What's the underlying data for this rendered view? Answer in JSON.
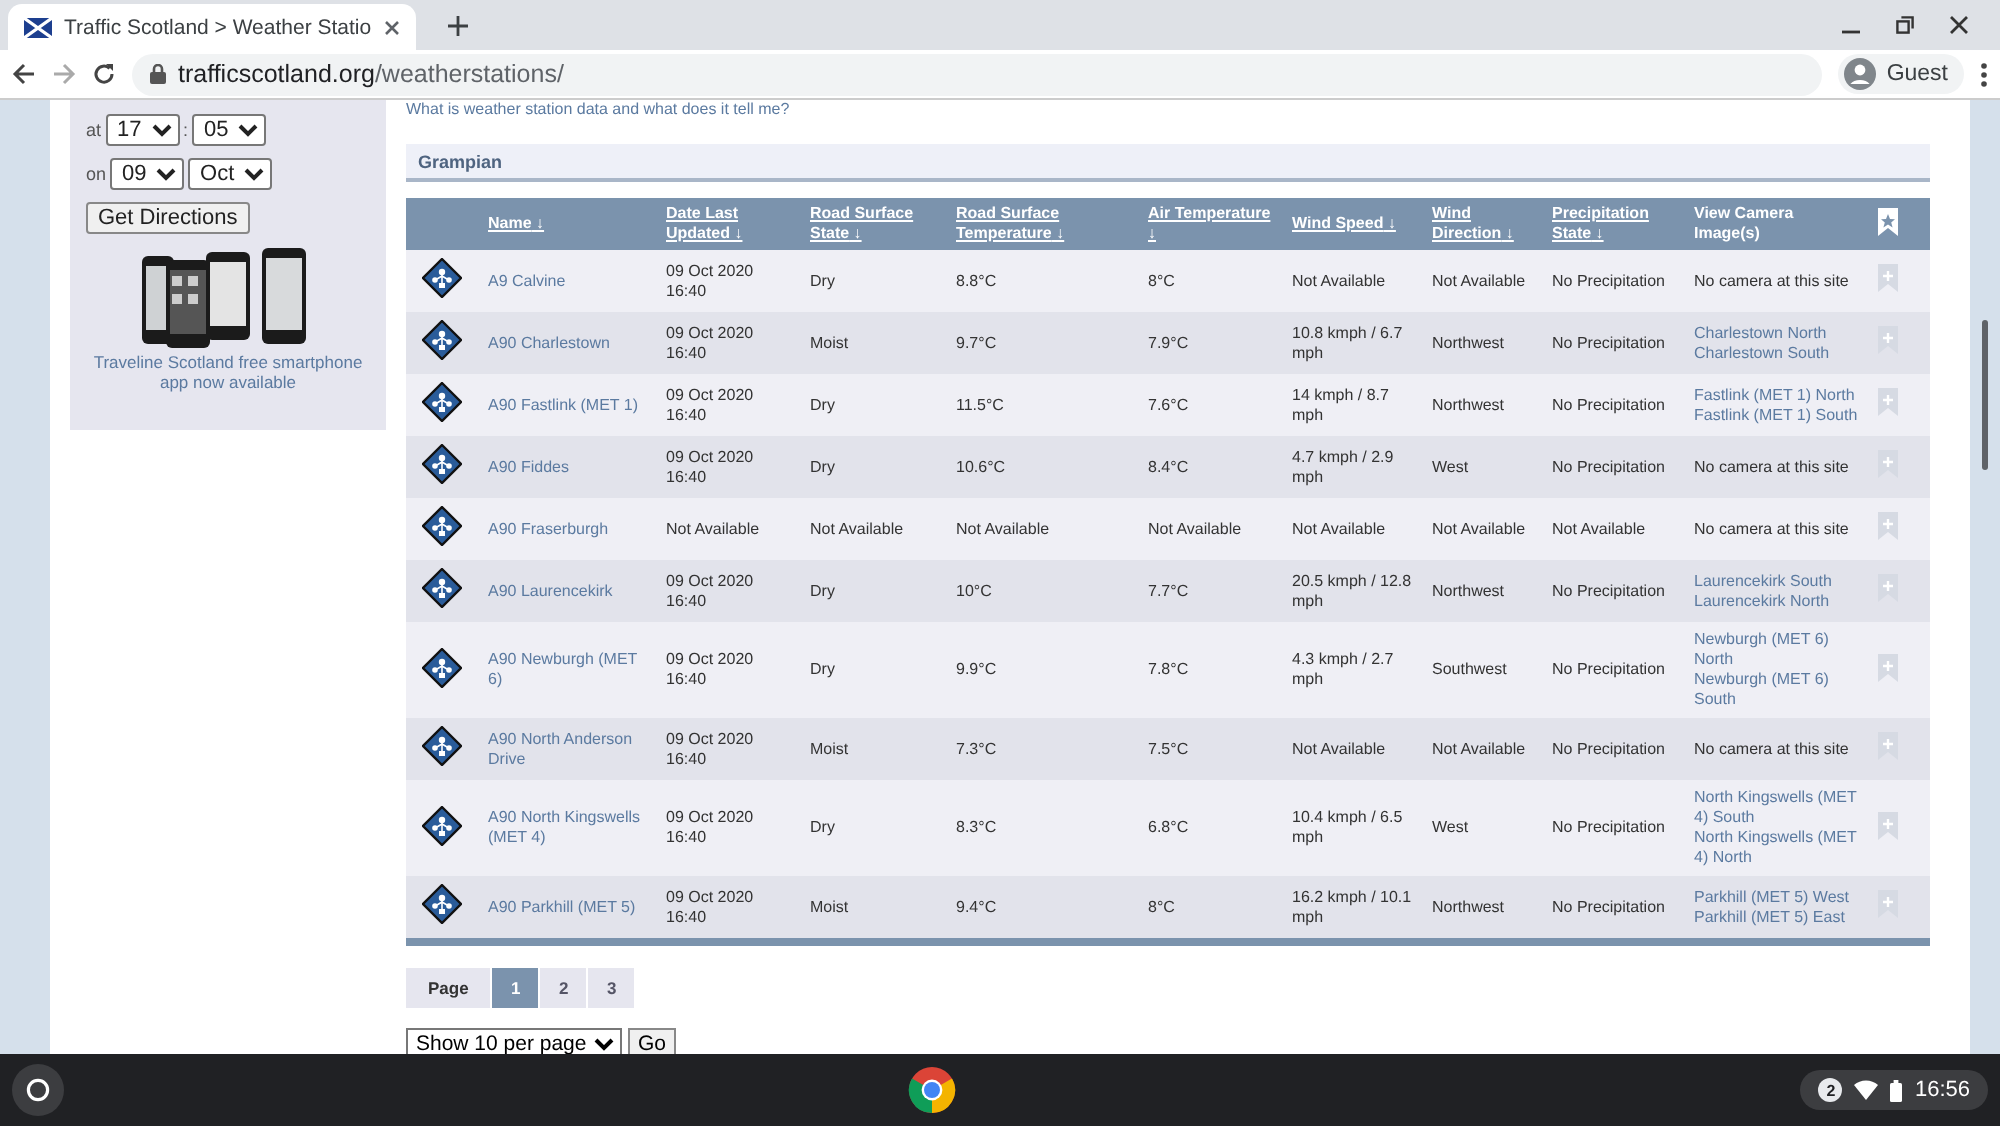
{
  "browser": {
    "tab_title": "Traffic Scotland > Weather Statio",
    "url_domain": "trafficscotland.org",
    "url_path": "/weatherstations/",
    "profile": "Guest"
  },
  "sidebar": {
    "time_label": "at",
    "hour": "17",
    "separator": ":",
    "minute": "05",
    "date_label": "on",
    "day": "09",
    "month": "Oct",
    "button": "Get Directions",
    "app_caption": "Traveline Scotland free smartphone app now available"
  },
  "intro_link": "What is weather station data and what does it tell me?",
  "region": "Grampian",
  "table": {
    "columns": [
      "Name",
      "Date Last Updated",
      "Road Surface State",
      "Road Surface Temperature",
      "Air Temperature",
      "Wind Speed",
      "Wind Direction",
      "Precipitation State",
      "View Camera Image(s)"
    ],
    "sortable": [
      true,
      true,
      true,
      true,
      true,
      true,
      true,
      true,
      false
    ],
    "sort_mark": "↓",
    "rows": [
      {
        "name": "A9 Calvine",
        "updated": "09 Oct 2020 16:40",
        "road_state": "Dry",
        "road_temp": "8.8°C",
        "air_temp": "8°C",
        "wind_speed": "Not Available",
        "wind_dir": "Not Available",
        "precip": "No Precipitation",
        "camera": {
          "kind": "none",
          "note": "No camera at this site"
        }
      },
      {
        "name": "A90 Charlestown",
        "updated": "09 Oct 2020 16:40",
        "road_state": "Moist",
        "road_temp": "9.7°C",
        "air_temp": "7.9°C",
        "wind_speed": "10.8 kmph / 6.7 mph",
        "wind_dir": "Northwest",
        "precip": "No Precipitation",
        "camera": {
          "kind": "links",
          "links": [
            "Charlestown North",
            "Charlestown South"
          ]
        }
      },
      {
        "name": "A90 Fastlink (MET 1)",
        "updated": "09 Oct 2020 16:40",
        "road_state": "Dry",
        "road_temp": "11.5°C",
        "air_temp": "7.6°C",
        "wind_speed": "14 kmph / 8.7 mph",
        "wind_dir": "Northwest",
        "precip": "No Precipitation",
        "camera": {
          "kind": "links",
          "links": [
            "Fastlink (MET 1) North",
            "Fastlink (MET 1) South"
          ]
        }
      },
      {
        "name": "A90 Fiddes",
        "updated": "09 Oct 2020 16:40",
        "road_state": "Dry",
        "road_temp": "10.6°C",
        "air_temp": "8.4°C",
        "wind_speed": "4.7 kmph / 2.9 mph",
        "wind_dir": "West",
        "precip": "No Precipitation",
        "camera": {
          "kind": "none",
          "note": "No camera at this site"
        }
      },
      {
        "name": "A90 Fraserburgh",
        "updated": "Not Available",
        "road_state": "Not Available",
        "road_temp": "Not Available",
        "air_temp": "Not Available",
        "wind_speed": "Not Available",
        "wind_dir": "Not Available",
        "precip": "Not Available",
        "camera": {
          "kind": "none",
          "note": "No camera at this site"
        }
      },
      {
        "name": "A90 Laurencekirk",
        "updated": "09 Oct 2020 16:40",
        "road_state": "Dry",
        "road_temp": "10°C",
        "air_temp": "7.7°C",
        "wind_speed": "20.5 kmph / 12.8 mph",
        "wind_dir": "Northwest",
        "precip": "No Precipitation",
        "camera": {
          "kind": "links",
          "links": [
            "Laurencekirk South",
            "Laurencekirk North"
          ]
        }
      },
      {
        "name": "A90 Newburgh (MET 6)",
        "updated": "09 Oct 2020 16:40",
        "road_state": "Dry",
        "road_temp": "9.9°C",
        "air_temp": "7.8°C",
        "wind_speed": "4.3 kmph / 2.7 mph",
        "wind_dir": "Southwest",
        "precip": "No Precipitation",
        "camera": {
          "kind": "links",
          "links": [
            "Newburgh (MET 6) North",
            "Newburgh (MET 6) South"
          ]
        }
      },
      {
        "name": "A90 North Anderson Drive",
        "updated": "09 Oct 2020 16:40",
        "road_state": "Moist",
        "road_temp": "7.3°C",
        "air_temp": "7.5°C",
        "wind_speed": "Not Available",
        "wind_dir": "Not Available",
        "precip": "No Precipitation",
        "camera": {
          "kind": "none",
          "note": "No camera at this site"
        }
      },
      {
        "name": "A90 North Kingswells (MET 4)",
        "updated": "09 Oct 2020 16:40",
        "road_state": "Dry",
        "road_temp": "8.3°C",
        "air_temp": "6.8°C",
        "wind_speed": "10.4 kmph / 6.5 mph",
        "wind_dir": "West",
        "precip": "No Precipitation",
        "camera": {
          "kind": "links",
          "links": [
            "North Kingswells (MET 4) South",
            "North Kingswells (MET 4) North"
          ]
        }
      },
      {
        "name": "A90 Parkhill (MET 5)",
        "updated": "09 Oct 2020 16:40",
        "road_state": "Moist",
        "road_temp": "9.4°C",
        "air_temp": "8°C",
        "wind_speed": "16.2 kmph / 10.1 mph",
        "wind_dir": "Northwest",
        "precip": "No Precipitation",
        "camera": {
          "kind": "links",
          "links": [
            "Parkhill (MET 5) West",
            "Parkhill (MET 5) East"
          ]
        }
      }
    ]
  },
  "pagination": {
    "label": "Page",
    "pages": [
      {
        "label": "1",
        "selected": true
      },
      {
        "label": "2",
        "selected": false
      },
      {
        "label": "3",
        "selected": false
      }
    ]
  },
  "per_page": {
    "value": "Show 10 per page",
    "button": "Go"
  },
  "taskbar": {
    "notifications": "2",
    "time": "16:56"
  }
}
